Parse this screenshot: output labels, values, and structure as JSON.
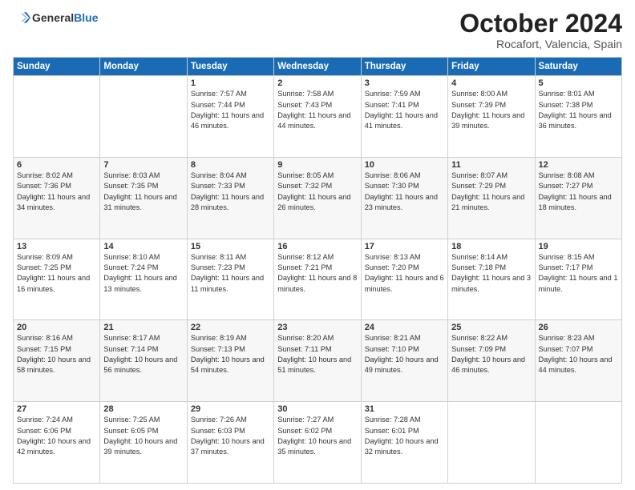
{
  "header": {
    "logo_line1": "General",
    "logo_line2": "Blue",
    "month": "October 2024",
    "location": "Rocafort, Valencia, Spain"
  },
  "weekdays": [
    "Sunday",
    "Monday",
    "Tuesday",
    "Wednesday",
    "Thursday",
    "Friday",
    "Saturday"
  ],
  "weeks": [
    [
      {
        "day": "",
        "sunrise": "",
        "sunset": "",
        "daylight": ""
      },
      {
        "day": "",
        "sunrise": "",
        "sunset": "",
        "daylight": ""
      },
      {
        "day": "1",
        "sunrise": "Sunrise: 7:57 AM",
        "sunset": "Sunset: 7:44 PM",
        "daylight": "Daylight: 11 hours and 46 minutes."
      },
      {
        "day": "2",
        "sunrise": "Sunrise: 7:58 AM",
        "sunset": "Sunset: 7:43 PM",
        "daylight": "Daylight: 11 hours and 44 minutes."
      },
      {
        "day": "3",
        "sunrise": "Sunrise: 7:59 AM",
        "sunset": "Sunset: 7:41 PM",
        "daylight": "Daylight: 11 hours and 41 minutes."
      },
      {
        "day": "4",
        "sunrise": "Sunrise: 8:00 AM",
        "sunset": "Sunset: 7:39 PM",
        "daylight": "Daylight: 11 hours and 39 minutes."
      },
      {
        "day": "5",
        "sunrise": "Sunrise: 8:01 AM",
        "sunset": "Sunset: 7:38 PM",
        "daylight": "Daylight: 11 hours and 36 minutes."
      }
    ],
    [
      {
        "day": "6",
        "sunrise": "Sunrise: 8:02 AM",
        "sunset": "Sunset: 7:36 PM",
        "daylight": "Daylight: 11 hours and 34 minutes."
      },
      {
        "day": "7",
        "sunrise": "Sunrise: 8:03 AM",
        "sunset": "Sunset: 7:35 PM",
        "daylight": "Daylight: 11 hours and 31 minutes."
      },
      {
        "day": "8",
        "sunrise": "Sunrise: 8:04 AM",
        "sunset": "Sunset: 7:33 PM",
        "daylight": "Daylight: 11 hours and 28 minutes."
      },
      {
        "day": "9",
        "sunrise": "Sunrise: 8:05 AM",
        "sunset": "Sunset: 7:32 PM",
        "daylight": "Daylight: 11 hours and 26 minutes."
      },
      {
        "day": "10",
        "sunrise": "Sunrise: 8:06 AM",
        "sunset": "Sunset: 7:30 PM",
        "daylight": "Daylight: 11 hours and 23 minutes."
      },
      {
        "day": "11",
        "sunrise": "Sunrise: 8:07 AM",
        "sunset": "Sunset: 7:29 PM",
        "daylight": "Daylight: 11 hours and 21 minutes."
      },
      {
        "day": "12",
        "sunrise": "Sunrise: 8:08 AM",
        "sunset": "Sunset: 7:27 PM",
        "daylight": "Daylight: 11 hours and 18 minutes."
      }
    ],
    [
      {
        "day": "13",
        "sunrise": "Sunrise: 8:09 AM",
        "sunset": "Sunset: 7:25 PM",
        "daylight": "Daylight: 11 hours and 16 minutes."
      },
      {
        "day": "14",
        "sunrise": "Sunrise: 8:10 AM",
        "sunset": "Sunset: 7:24 PM",
        "daylight": "Daylight: 11 hours and 13 minutes."
      },
      {
        "day": "15",
        "sunrise": "Sunrise: 8:11 AM",
        "sunset": "Sunset: 7:23 PM",
        "daylight": "Daylight: 11 hours and 11 minutes."
      },
      {
        "day": "16",
        "sunrise": "Sunrise: 8:12 AM",
        "sunset": "Sunset: 7:21 PM",
        "daylight": "Daylight: 11 hours and 8 minutes."
      },
      {
        "day": "17",
        "sunrise": "Sunrise: 8:13 AM",
        "sunset": "Sunset: 7:20 PM",
        "daylight": "Daylight: 11 hours and 6 minutes."
      },
      {
        "day": "18",
        "sunrise": "Sunrise: 8:14 AM",
        "sunset": "Sunset: 7:18 PM",
        "daylight": "Daylight: 11 hours and 3 minutes."
      },
      {
        "day": "19",
        "sunrise": "Sunrise: 8:15 AM",
        "sunset": "Sunset: 7:17 PM",
        "daylight": "Daylight: 11 hours and 1 minute."
      }
    ],
    [
      {
        "day": "20",
        "sunrise": "Sunrise: 8:16 AM",
        "sunset": "Sunset: 7:15 PM",
        "daylight": "Daylight: 10 hours and 58 minutes."
      },
      {
        "day": "21",
        "sunrise": "Sunrise: 8:17 AM",
        "sunset": "Sunset: 7:14 PM",
        "daylight": "Daylight: 10 hours and 56 minutes."
      },
      {
        "day": "22",
        "sunrise": "Sunrise: 8:19 AM",
        "sunset": "Sunset: 7:13 PM",
        "daylight": "Daylight: 10 hours and 54 minutes."
      },
      {
        "day": "23",
        "sunrise": "Sunrise: 8:20 AM",
        "sunset": "Sunset: 7:11 PM",
        "daylight": "Daylight: 10 hours and 51 minutes."
      },
      {
        "day": "24",
        "sunrise": "Sunrise: 8:21 AM",
        "sunset": "Sunset: 7:10 PM",
        "daylight": "Daylight: 10 hours and 49 minutes."
      },
      {
        "day": "25",
        "sunrise": "Sunrise: 8:22 AM",
        "sunset": "Sunset: 7:09 PM",
        "daylight": "Daylight: 10 hours and 46 minutes."
      },
      {
        "day": "26",
        "sunrise": "Sunrise: 8:23 AM",
        "sunset": "Sunset: 7:07 PM",
        "daylight": "Daylight: 10 hours and 44 minutes."
      }
    ],
    [
      {
        "day": "27",
        "sunrise": "Sunrise: 7:24 AM",
        "sunset": "Sunset: 6:06 PM",
        "daylight": "Daylight: 10 hours and 42 minutes."
      },
      {
        "day": "28",
        "sunrise": "Sunrise: 7:25 AM",
        "sunset": "Sunset: 6:05 PM",
        "daylight": "Daylight: 10 hours and 39 minutes."
      },
      {
        "day": "29",
        "sunrise": "Sunrise: 7:26 AM",
        "sunset": "Sunset: 6:03 PM",
        "daylight": "Daylight: 10 hours and 37 minutes."
      },
      {
        "day": "30",
        "sunrise": "Sunrise: 7:27 AM",
        "sunset": "Sunset: 6:02 PM",
        "daylight": "Daylight: 10 hours and 35 minutes."
      },
      {
        "day": "31",
        "sunrise": "Sunrise: 7:28 AM",
        "sunset": "Sunset: 6:01 PM",
        "daylight": "Daylight: 10 hours and 32 minutes."
      },
      {
        "day": "",
        "sunrise": "",
        "sunset": "",
        "daylight": ""
      },
      {
        "day": "",
        "sunrise": "",
        "sunset": "",
        "daylight": ""
      }
    ]
  ]
}
